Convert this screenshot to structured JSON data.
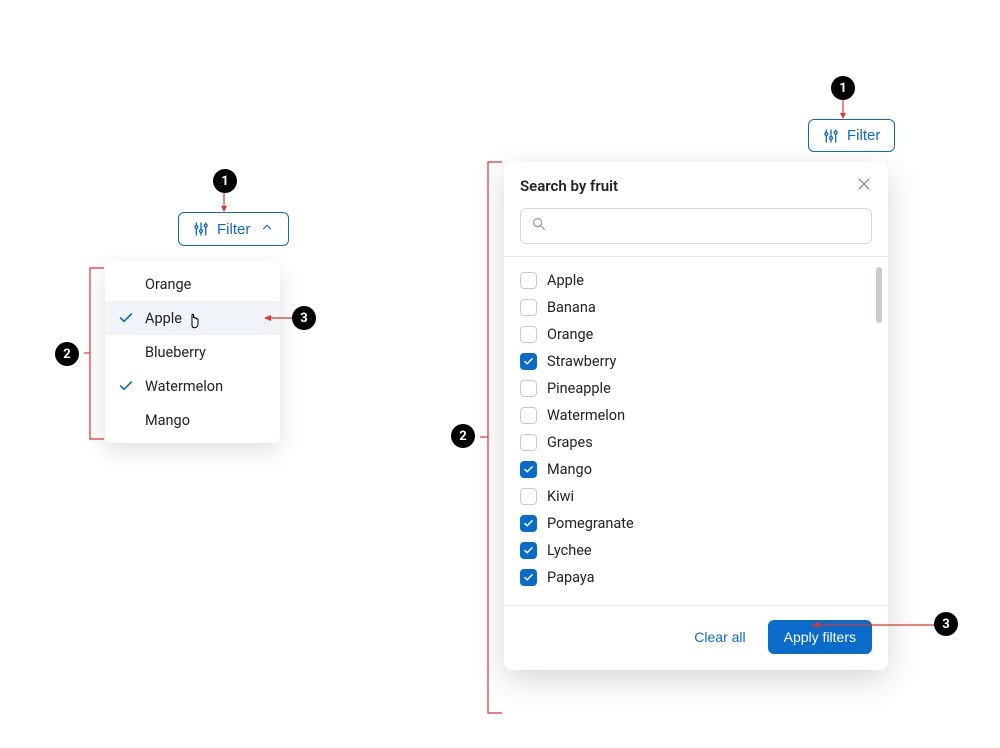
{
  "left": {
    "filter_label": "Filter",
    "items": [
      {
        "label": "Orange",
        "selected": false
      },
      {
        "label": "Apple",
        "selected": true
      },
      {
        "label": "Blueberry",
        "selected": false
      },
      {
        "label": "Watermelon",
        "selected": true
      },
      {
        "label": "Mango",
        "selected": false
      }
    ],
    "hovered_index": 1
  },
  "right": {
    "filter_label": "Filter",
    "panel_title": "Search by fruit",
    "search_placeholder": "",
    "items": [
      {
        "label": "Apple",
        "checked": false
      },
      {
        "label": "Banana",
        "checked": false
      },
      {
        "label": "Orange",
        "checked": false
      },
      {
        "label": "Strawberry",
        "checked": true
      },
      {
        "label": "Pineapple",
        "checked": false
      },
      {
        "label": "Watermelon",
        "checked": false
      },
      {
        "label": "Grapes",
        "checked": false
      },
      {
        "label": "Mango",
        "checked": true
      },
      {
        "label": "Kiwi",
        "checked": false
      },
      {
        "label": "Pomegranate",
        "checked": true
      },
      {
        "label": "Lychee",
        "checked": true
      },
      {
        "label": "Papaya",
        "checked": true
      }
    ],
    "clear_label": "Clear all",
    "apply_label": "Apply filters"
  },
  "annotations": {
    "b1": "1",
    "b2": "2",
    "b3": "3"
  }
}
